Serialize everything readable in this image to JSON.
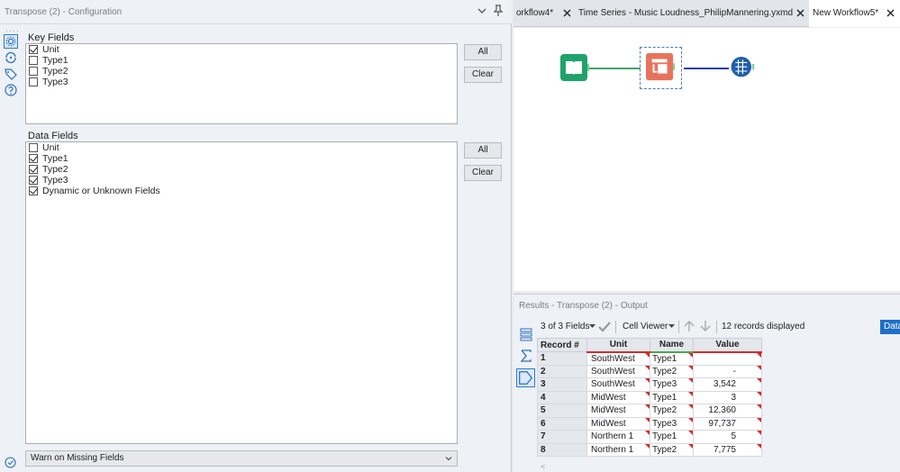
{
  "config": {
    "title": "Transpose (2) - Configuration",
    "key_fields_label": "Key Fields",
    "key_fields": [
      {
        "label": "Unit",
        "checked": true
      },
      {
        "label": "Type1",
        "checked": false
      },
      {
        "label": "Type2",
        "checked": false
      },
      {
        "label": "Type3",
        "checked": false
      }
    ],
    "data_fields_label": "Data Fields",
    "data_fields": [
      {
        "label": "Unit",
        "checked": false
      },
      {
        "label": "Type1",
        "checked": true
      },
      {
        "label": "Type2",
        "checked": true
      },
      {
        "label": "Type3",
        "checked": true
      },
      {
        "label": "Dynamic or Unknown Fields",
        "checked": true
      }
    ],
    "all_label": "All",
    "clear_label": "Clear",
    "missing_fields_option": "Warn on Missing Fields"
  },
  "tabs": [
    {
      "label": "orkflow4*",
      "active": false
    },
    {
      "label": "Time Series - Music Loudness_PhilipMannering.yxmd",
      "active": false
    },
    {
      "label": "New Workflow5*",
      "active": true
    }
  ],
  "results": {
    "title": "Results - Transpose (2) - Output",
    "fields_selector": "3 of 3 Fields",
    "viewer": "Cell Viewer",
    "records_displayed": "12 records displayed",
    "data_button": "Data",
    "columns": [
      "Record #",
      "Unit",
      "Name",
      "Value"
    ],
    "rows": [
      {
        "rec": "1",
        "unit": "SouthWest",
        "name": "Type1",
        "value": ""
      },
      {
        "rec": "2",
        "unit": "SouthWest",
        "name": "Type2",
        "value": "-"
      },
      {
        "rec": "3",
        "unit": "SouthWest",
        "name": "Type3",
        "value": "3,542"
      },
      {
        "rec": "4",
        "unit": "MidWest",
        "name": "Type1",
        "value": "3"
      },
      {
        "rec": "5",
        "unit": "MidWest",
        "name": "Type2",
        "value": "12,360"
      },
      {
        "rec": "6",
        "unit": "MidWest",
        "name": "Type3",
        "value": "97,737"
      },
      {
        "rec": "7",
        "unit": "Northern 1",
        "name": "Type1",
        "value": "5"
      },
      {
        "rec": "8",
        "unit": "Northern 1",
        "name": "Type2",
        "value": "7,775"
      }
    ]
  },
  "colors": {
    "accent": "#1e6fc8",
    "input_tool": "#1fa36b",
    "transpose_tool": "#e8735c",
    "browse_tool": "#1f5fa8",
    "flag": "#d62b2b"
  }
}
